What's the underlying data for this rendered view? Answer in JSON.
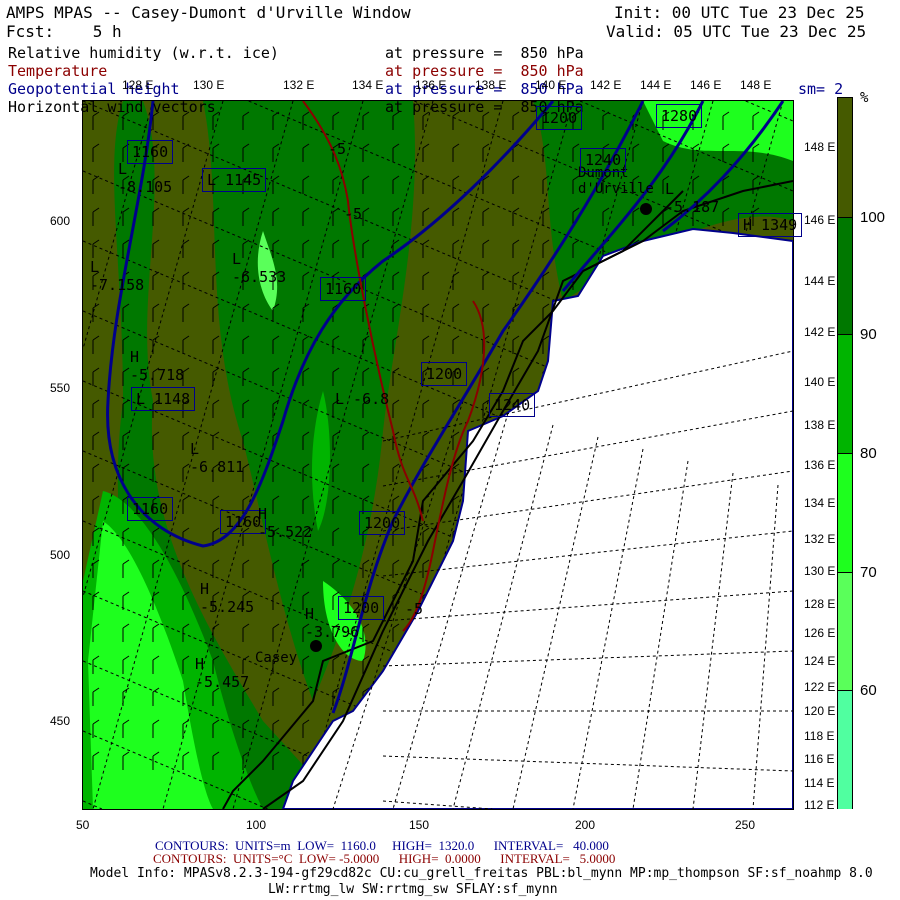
{
  "header": {
    "title": "AMPS MPAS -- Casey-Dumont d'Urville Window",
    "init": "Init: 00 UTC Tue 23 Dec 25",
    "fcst": "Fcst:    5 h",
    "valid": "Valid: 05 UTC Tue 23 Dec 25",
    "fields": [
      {
        "name": "Relative humidity (w.r.t. ice)",
        "level": "at pressure =  850 hPa",
        "color": "#000000"
      },
      {
        "name": "Temperature",
        "level": "at pressure =  850 hPa",
        "color": "#8b0000"
      },
      {
        "name": "Geopotential height",
        "level": "at pressure =  850 hPa",
        "color": "#00008b"
      },
      {
        "name": "Horizontal wind vectors",
        "level": "at pressure =  850 hPa",
        "color": "#000000"
      }
    ],
    "smoothing": "sm= 2"
  },
  "map": {
    "lon_labels_top": [
      "128 E",
      "130 E",
      "132 E",
      "134 E",
      "136 E",
      "138 E",
      "140 E",
      "142 E",
      "144 E",
      "146 E",
      "148 E"
    ],
    "lon_labels_right": [
      "148 E",
      "146 E",
      "144 E",
      "142 E",
      "140 E",
      "138 E",
      "136 E",
      "134 E",
      "132 E",
      "130 E",
      "128 E",
      "126 E",
      "124 E",
      "122 E",
      "120 E",
      "118 E",
      "116 E",
      "114 E",
      "112 E"
    ],
    "y_ticks": [
      "600",
      "550",
      "500",
      "450"
    ],
    "x_ticks": [
      "50",
      "100",
      "150",
      "200",
      "250"
    ],
    "stations": [
      "Casey",
      "Dumont d'Urville"
    ],
    "height_labels": [
      {
        "text": "1160"
      },
      {
        "text": "L 1145"
      },
      {
        "text": "1160"
      },
      {
        "text": "L 1148"
      },
      {
        "text": "1160"
      },
      {
        "text": "1160"
      },
      {
        "text": "1200"
      },
      {
        "text": "1200"
      },
      {
        "text": "1200"
      },
      {
        "text": "1240"
      },
      {
        "text": "1200"
      },
      {
        "text": "1240"
      },
      {
        "text": "1280"
      },
      {
        "text": "H 1349"
      }
    ],
    "temp_labels": [
      {
        "text": "L -8.105"
      },
      {
        "text": "L -7.158"
      },
      {
        "text": "L -6.533"
      },
      {
        "text": "H -5.718"
      },
      {
        "text": "L -6.811"
      },
      {
        "text": "L -6.8"
      },
      {
        "text": "H -5.522"
      },
      {
        "text": "H -5.245"
      },
      {
        "text": "H -5.457"
      },
      {
        "text": "H -3.796"
      },
      {
        "text": "L -5.187"
      },
      {
        "text": "-5"
      },
      {
        "text": "-5"
      },
      {
        "text": "-5"
      }
    ]
  },
  "colorbar": {
    "unit": "%",
    "labels": [
      "100",
      "90",
      "80",
      "70",
      "60"
    ],
    "colors": [
      "#455a00",
      "#007800",
      "#00b400",
      "#1eff1e",
      "#5aff5a",
      "#50ffa0"
    ]
  },
  "footer": {
    "height_contours": {
      "label": "CONTOURS:",
      "units": "UNITS=m",
      "low": "LOW=  1160.0",
      "high": "HIGH=  1320.0",
      "interval": "INTERVAL=   40.000"
    },
    "temp_contours": {
      "label": "CONTOURS:",
      "units": "UNITS=°C",
      "low": "LOW= -5.0000",
      "high": "HIGH=  0.0000",
      "interval": "INTERVAL=   5.0000"
    },
    "model_info": "Model Info: MPASv8.2.3-194-gf29cd82c CU:cu_grell_freitas PBL:bl_mynn MP:mp_thompson SF:sf_noahmp 8.0",
    "model_info2": "LW:rrtmg_lw SW:rrtmg_sw SFLAY:sf_mynn"
  }
}
